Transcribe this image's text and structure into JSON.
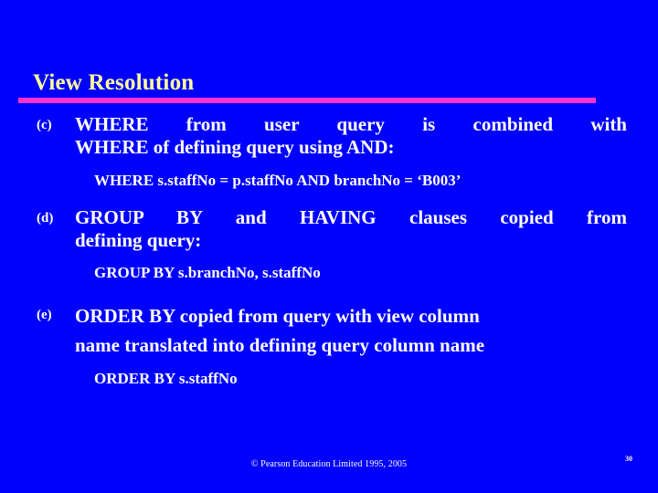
{
  "slide": {
    "background_color": "#0000FF",
    "title": "View Resolution",
    "title_color": "#FFFF99",
    "rule_color": "#FF33CC",
    "text_color": "#FFFFFF"
  },
  "points": [
    {
      "marker": "(c)",
      "line1": "WHERE from user query is combined with",
      "line2": "WHERE of defining query using AND:",
      "code": "WHERE s.staffNo = p.staffNo AND branchNo = ‘B003’"
    },
    {
      "marker": "(d)",
      "line1": "GROUP BY and HAVING clauses copied from",
      "line2": "defining query:",
      "code": "GROUP BY s.branchNo, s.staffNo"
    },
    {
      "marker": "(e)",
      "line1": "ORDER BY copied from query with view column",
      "line2": "name translated into defining query column name",
      "code": "ORDER BY s.staffNo"
    }
  ],
  "footer": {
    "copyright": "© Pearson Education Limited 1995, 2005",
    "page_number": "30"
  }
}
